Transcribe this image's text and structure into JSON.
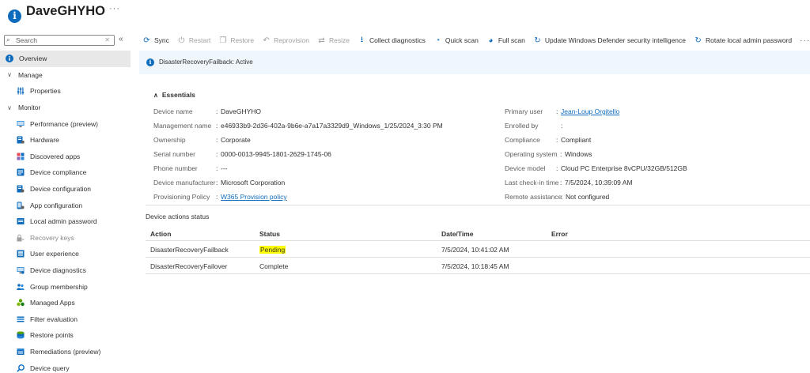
{
  "header": {
    "title": "DaveGHYHO",
    "more": "···"
  },
  "search": {
    "placeholder": "Search",
    "clear": "✕",
    "collapse": "«"
  },
  "nav": {
    "items": [
      {
        "label": "Overview",
        "chev": ""
      },
      {
        "label": "Manage",
        "chev": "∨"
      },
      {
        "label": "Properties"
      },
      {
        "label": "Monitor",
        "chev": "∨"
      },
      {
        "label": "Performance (preview)"
      },
      {
        "label": "Hardware"
      },
      {
        "label": "Discovered apps"
      },
      {
        "label": "Device compliance"
      },
      {
        "label": "Device configuration"
      },
      {
        "label": "App configuration"
      },
      {
        "label": "Local admin password"
      },
      {
        "label": "Recovery keys"
      },
      {
        "label": "User experience"
      },
      {
        "label": "Device diagnostics"
      },
      {
        "label": "Group membership"
      },
      {
        "label": "Managed Apps"
      },
      {
        "label": "Filter evaluation"
      },
      {
        "label": "Restore points"
      },
      {
        "label": "Remediations (preview)"
      },
      {
        "label": "Device query"
      }
    ]
  },
  "toolbar": {
    "sync": "Sync",
    "restart": "Restart",
    "restore": "Restore",
    "reprovision": "Reprovision",
    "resize": "Resize",
    "collect": "Collect diagnostics",
    "quick": "Quick scan",
    "full": "Full scan",
    "update": "Update Windows Defender security intelligence",
    "rotate": "Rotate local admin password",
    "more": "···"
  },
  "banner": {
    "text": "DisasterRecoveryFailback: Active"
  },
  "essentials": {
    "title": "Essentials",
    "left": [
      {
        "label": "Device name",
        "value": "DaveGHYHO"
      },
      {
        "label": "Management name",
        "value": "e46933b9-2d36-402a-9b6e-a7a17a3329d9_Windows_1/25/2024_3:30 PM"
      },
      {
        "label": "Ownership",
        "value": "Corporate"
      },
      {
        "label": "Serial number",
        "value": "0000-0013-9945-1801-2629-1745-06"
      },
      {
        "label": "Phone number",
        "value": "---"
      },
      {
        "label": "Device manufacturer",
        "value": "Microsoft Corporation"
      },
      {
        "label": "Provisioning Policy",
        "value": "W365 Provision policy"
      }
    ],
    "right": [
      {
        "label": "Primary user",
        "value": "Jean-Loup Orgitello"
      },
      {
        "label": "Enrolled by",
        "value": ""
      },
      {
        "label": "Compliance",
        "value": "Compliant"
      },
      {
        "label": "Operating system",
        "value": "Windows"
      },
      {
        "label": "Device model",
        "value": "Cloud PC Enterprise 8vCPU/32GB/512GB"
      },
      {
        "label": "Last check-in time",
        "value": "7/5/2024, 10:39:09 AM"
      },
      {
        "label": "Remote assistance",
        "value": "Not configured"
      }
    ]
  },
  "actions": {
    "title": "Device actions status",
    "headers": [
      "Action",
      "Status",
      "Date/Time",
      "Error"
    ],
    "rows": [
      [
        "DisasterRecoveryFailback",
        "Pending",
        "7/5/2024, 10:41:02 AM",
        ""
      ],
      [
        "DisasterRecoveryFailover",
        "Complete",
        "7/5/2024, 10:18:45 AM",
        ""
      ]
    ]
  },
  "colors": {
    "accent": "#0f6cbd",
    "banner_bg": "#eff6fc",
    "pending_highlight": "#ffff00",
    "active_nav_bg": "#e8e8e8"
  }
}
